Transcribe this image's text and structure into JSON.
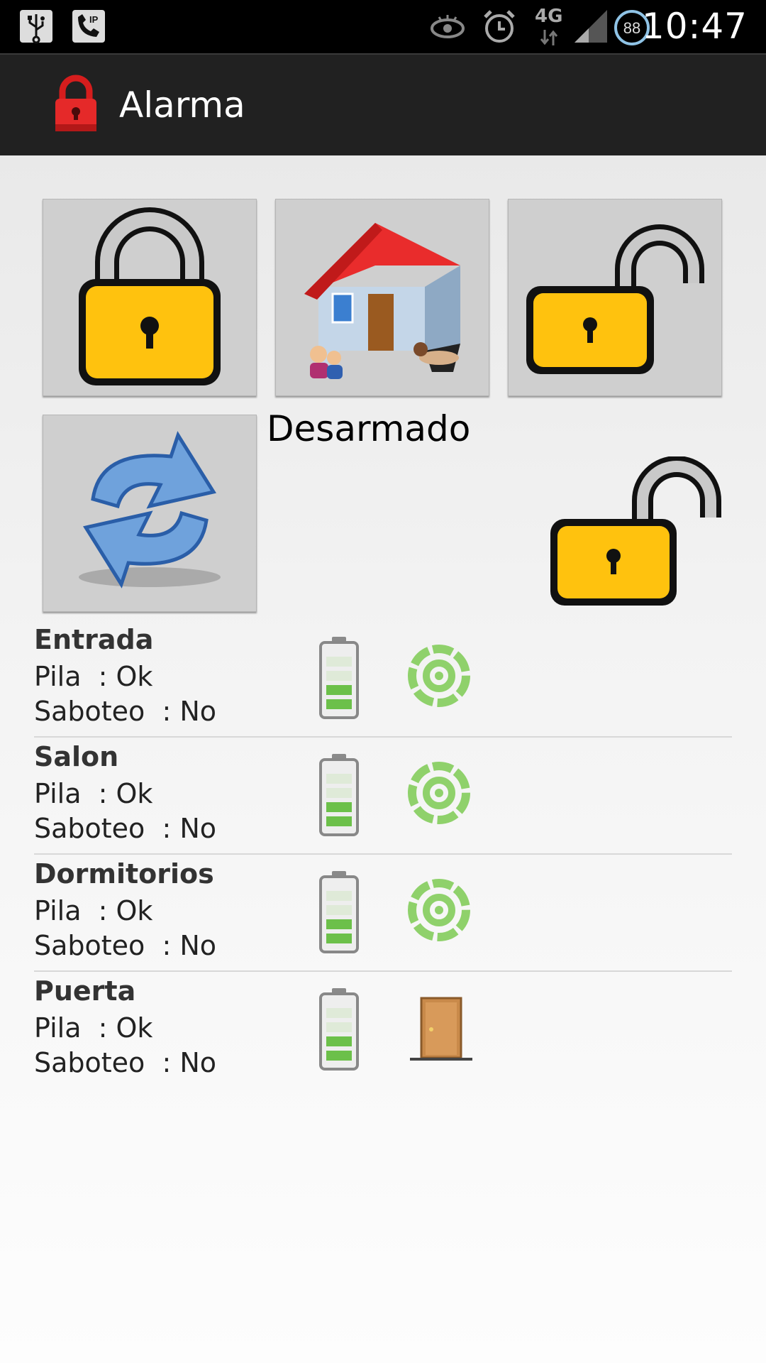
{
  "status_bar": {
    "time": "10:47",
    "network": "4G",
    "battery_level": "88",
    "icons": [
      "usb-icon",
      "sip-call-icon",
      "eye-icon",
      "alarm-clock-icon",
      "data-transfer-icon",
      "signal-icon",
      "battery-icon"
    ]
  },
  "action_bar": {
    "title": "Alarma",
    "icon": "red-lock-icon"
  },
  "controls": {
    "buttons": [
      {
        "name": "arm-button",
        "icon": "closed-lock-icon"
      },
      {
        "name": "home-mode-button",
        "icon": "house-icon"
      },
      {
        "name": "disarm-button",
        "icon": "open-lock-icon"
      },
      {
        "name": "refresh-button",
        "icon": "refresh-icon"
      }
    ],
    "state_label": "Desarmado",
    "state_icon": "open-lock-icon"
  },
  "zones": [
    {
      "name": "Entrada",
      "pila": "Pila  : Ok",
      "saboteo": "Saboteo  : No",
      "sensor_icon": "motion-sensor-icon"
    },
    {
      "name": "Salon",
      "pila": "Pila  : Ok",
      "saboteo": "Saboteo  : No",
      "sensor_icon": "motion-sensor-icon"
    },
    {
      "name": "Dormitorios",
      "pila": "Pila  : Ok",
      "saboteo": "Saboteo  : No",
      "sensor_icon": "motion-sensor-icon"
    },
    {
      "name": "Puerta",
      "pila": "Pila  : Ok",
      "saboteo": "Saboteo  : No",
      "sensor_icon": "door-icon"
    }
  ],
  "colors": {
    "status_bar": "#000000",
    "action_bar": "#212121",
    "lock_yellow": "#ffc20e",
    "sensor_green": "#8fd16b"
  }
}
